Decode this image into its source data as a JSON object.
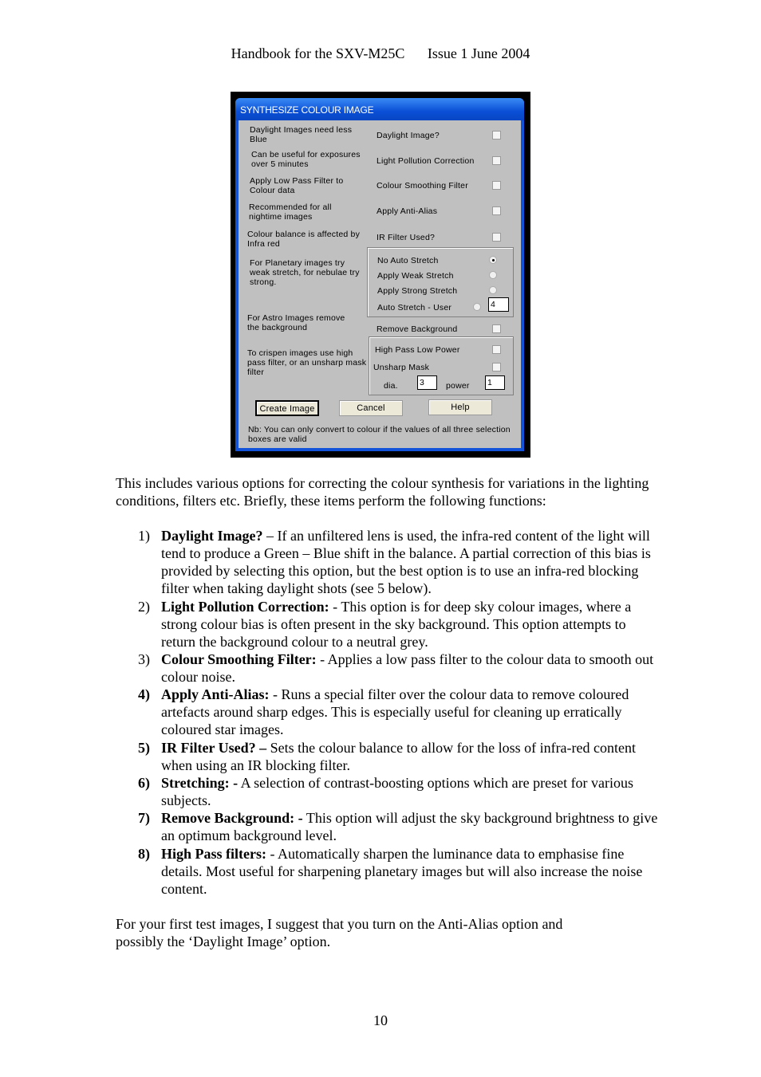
{
  "header": {
    "title": "Handbook for the SXV-M25C",
    "issue": "Issue 1 June 2004"
  },
  "dialog": {
    "title": "SYNTHESIZE COLOUR IMAGE",
    "accent": "#0a4fd6",
    "hints": [
      "Daylight Images need less Blue",
      "Can be useful for exposures over 5 minutes",
      "Apply Low Pass Filter to Colour data",
      "Recommended for all nightime images",
      "Colour balance is affected by Infra red",
      "For Planetary images try weak stretch, for nebulae try strong.",
      "For Astro Images remove the background",
      "To crispen images use high pass filter, or an unsharp mask filter"
    ],
    "checkboxes": [
      {
        "label": "Daylight Image?",
        "checked": false
      },
      {
        "label": "Light Pollution Correction",
        "checked": false
      },
      {
        "label": "Colour Smoothing Filter",
        "checked": false
      },
      {
        "label": "Apply Anti-Alias",
        "checked": false
      },
      {
        "label": "IR Filter Used?",
        "checked": false
      }
    ],
    "stretch": [
      {
        "label": "No Auto Stretch",
        "selected": true
      },
      {
        "label": "Apply Weak Stretch",
        "selected": false
      },
      {
        "label": "Apply Strong Stretch",
        "selected": false
      },
      {
        "label": "Auto Stretch - User",
        "selected": false
      }
    ],
    "stretch_user_value": "4",
    "remove_background": {
      "label": "Remove Background",
      "checked": false
    },
    "high_pass": {
      "label": "High Pass Low Power",
      "checked": false
    },
    "unsharp": {
      "label": "Unsharp Mask",
      "checked": false
    },
    "dia_label": "dia.",
    "dia_value": "3",
    "power_label": "power",
    "power_value": "1",
    "buttons": {
      "create": "Create Image",
      "cancel": "Cancel",
      "help": "Help"
    },
    "note": "Nb: You can only convert to colour if the values of all three selection boxes are valid"
  },
  "intro": "This includes various options for correcting the colour synthesis for variations in the lighting conditions, filters etc. Briefly, these items perform the following functions:",
  "items": [
    {
      "num": "1)",
      "term": "Daylight Image?",
      "text": " – If an unfiltered lens is used, the infra-red content of the light will tend to produce a Green – Blue shift in the balance. A partial correction of this bias is provided by selecting this option, but the best option is to use an infra-red blocking filter when taking daylight shots (see 5 below)."
    },
    {
      "num": "2)",
      "term": "Light Pollution Correction:",
      "text": " - This option is for deep sky colour images, where a strong colour bias is often present in the sky background. This option attempts to return the background colour to a neutral grey."
    },
    {
      "num": "3)",
      "term": "Colour Smoothing Filter:",
      "text": " - Applies a low pass filter to the colour data to smooth out colour noise."
    },
    {
      "num": "4)",
      "term": "Apply Anti-Alias:",
      "text": " - Runs a special filter over the colour data to remove coloured artefacts around sharp edges. This is especially useful for cleaning up erratically coloured star images."
    },
    {
      "num": "5)",
      "term": "IR Filter Used? –",
      "text": " Sets the colour balance to allow for the loss of infra-red content when using an IR blocking filter."
    },
    {
      "num": "6)",
      "term": "Stretching: -",
      "text": " A selection of contrast-boosting options which are preset for various subjects."
    },
    {
      "num": "7)",
      "term": "Remove Background: -",
      "text": " This option will adjust the sky background brightness to give an optimum background level."
    },
    {
      "num": "8)",
      "term": "High Pass filters:",
      "text": " - Automatically sharpen the luminance data to emphasise fine details. Most useful for sharpening planetary images but will also increase the noise content."
    }
  ],
  "closing": "For your first test images, I suggest that you turn on the Anti-Alias option and possibly the ‘Daylight Image’ option.",
  "page_number": "10"
}
